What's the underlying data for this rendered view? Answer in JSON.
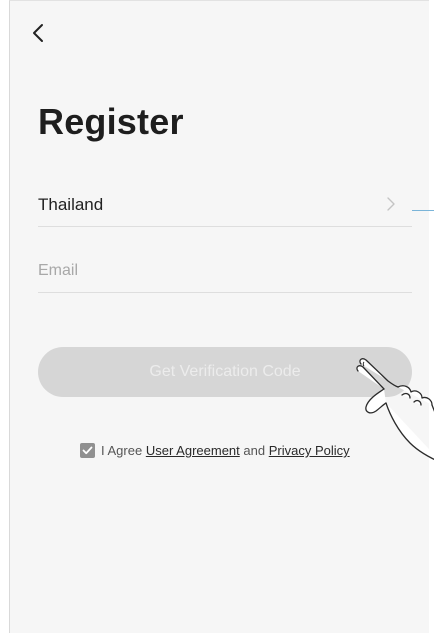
{
  "header": {
    "back_icon": "chevron-left-icon",
    "title": "Register"
  },
  "form": {
    "country": {
      "value": "Thailand",
      "chevron_icon": "chevron-right-icon"
    },
    "email": {
      "placeholder": "Email",
      "value": ""
    },
    "verify_button_label": "Get Verification Code"
  },
  "agreement": {
    "checked": true,
    "prefix": "I Agree",
    "user_agreement_label": "User Agreement",
    "conjunction": "and",
    "privacy_policy_label": "Privacy Policy"
  },
  "colors": {
    "background": "#f6f6f6",
    "button_disabled": "#d6d6d6",
    "checkbox": "#909090",
    "side_line": "#7ab4d8"
  },
  "overlay": {
    "hand_icon": "pointing-hand-icon"
  }
}
